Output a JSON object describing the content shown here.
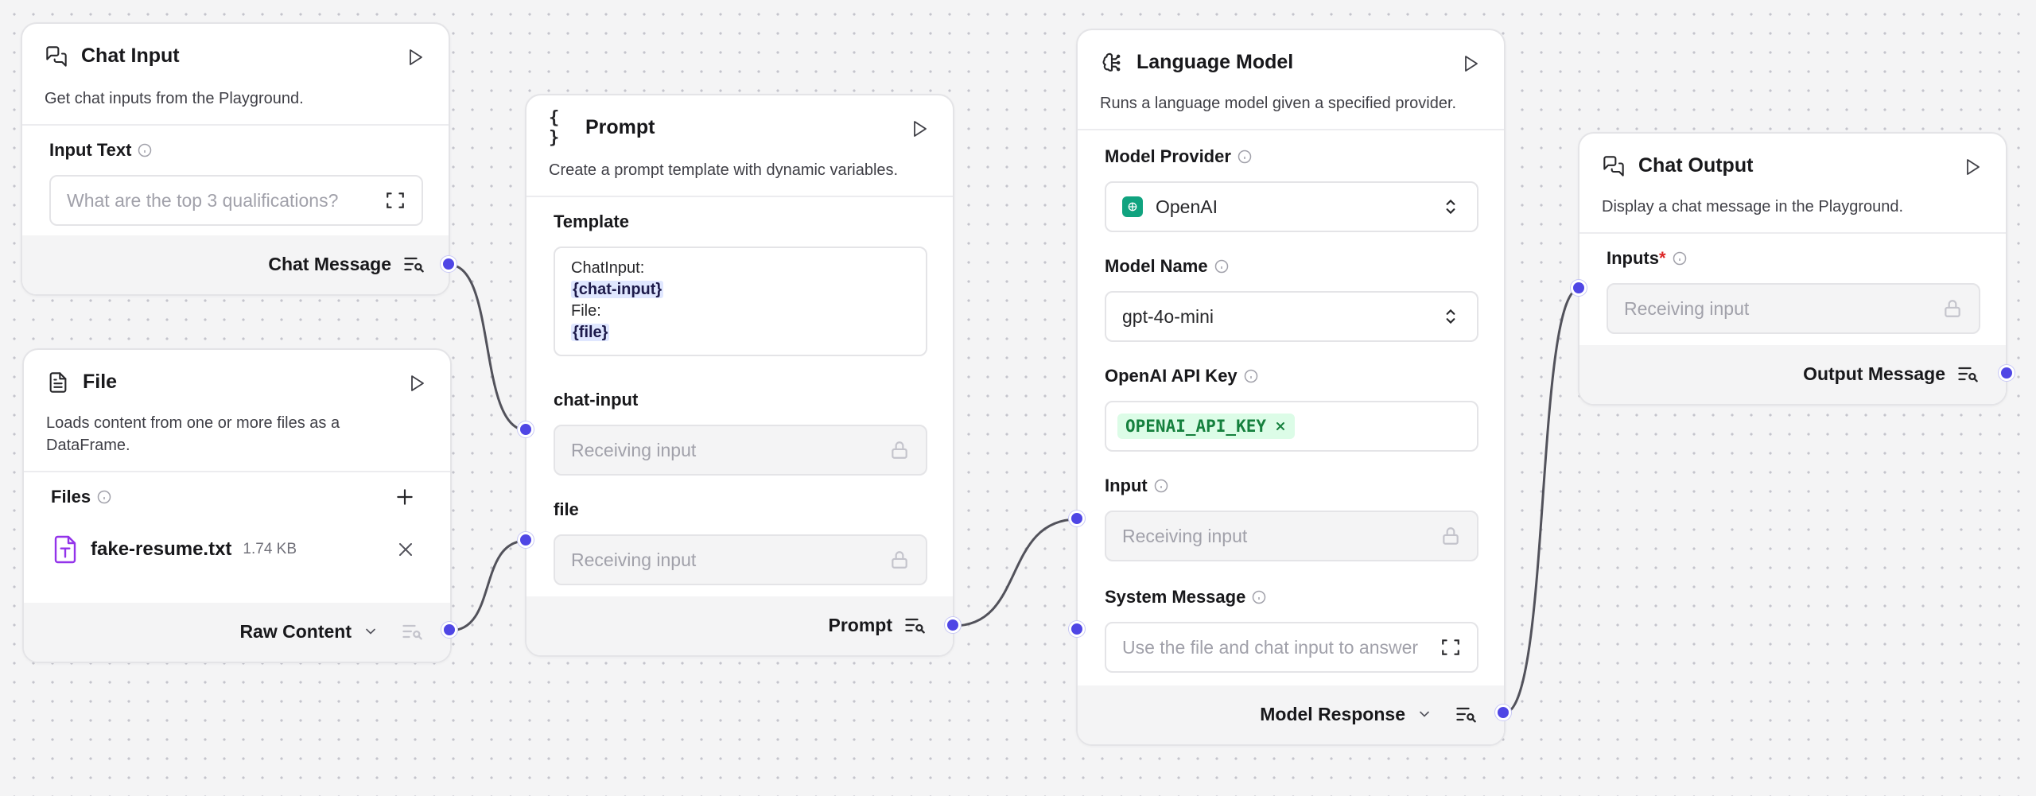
{
  "chat_input": {
    "title": "Chat Input",
    "description": "Get chat inputs from the Playground.",
    "input_label": "Input Text",
    "input_placeholder": "What are the top 3 qualifications?",
    "output_label": "Chat Message"
  },
  "file": {
    "title": "File",
    "description": "Loads content from one or more files as a DataFrame.",
    "files_label": "Files",
    "file_name": "fake-resume.txt",
    "file_size": "1.74 KB",
    "output_label": "Raw Content"
  },
  "prompt": {
    "title": "Prompt",
    "description": "Create a prompt template with dynamic variables.",
    "template_label": "Template",
    "template_lines": [
      "ChatInput:",
      "{chat-input}",
      "File:",
      "{file}"
    ],
    "chat_input_label": "chat-input",
    "chat_input_placeholder": "Receiving input",
    "file_label": "file",
    "file_placeholder": "Receiving input",
    "output_label": "Prompt"
  },
  "language_model": {
    "title": "Language Model",
    "description": "Runs a language model given a specified provider.",
    "provider_label": "Model Provider",
    "provider_value": "OpenAI",
    "model_name_label": "Model Name",
    "model_name_value": "gpt-4o-mini",
    "api_key_label": "OpenAI API Key",
    "api_key_value": "OPENAI_API_KEY",
    "input_label": "Input",
    "input_placeholder": "Receiving input",
    "system_message_label": "System Message",
    "system_message_placeholder": "Use the file and chat input to answer",
    "output_label": "Model Response"
  },
  "chat_output": {
    "title": "Chat Output",
    "description": "Display a chat message in the Playground.",
    "inputs_label": "Inputs",
    "required_mark": "*",
    "inputs_placeholder": "Receiving input",
    "output_label": "Output Message"
  },
  "colors": {
    "handle": "#4f46e5",
    "edge": "#52525b",
    "badge_bg": "#dcfce7",
    "badge_text": "#15803d",
    "required": "#dc2626"
  }
}
